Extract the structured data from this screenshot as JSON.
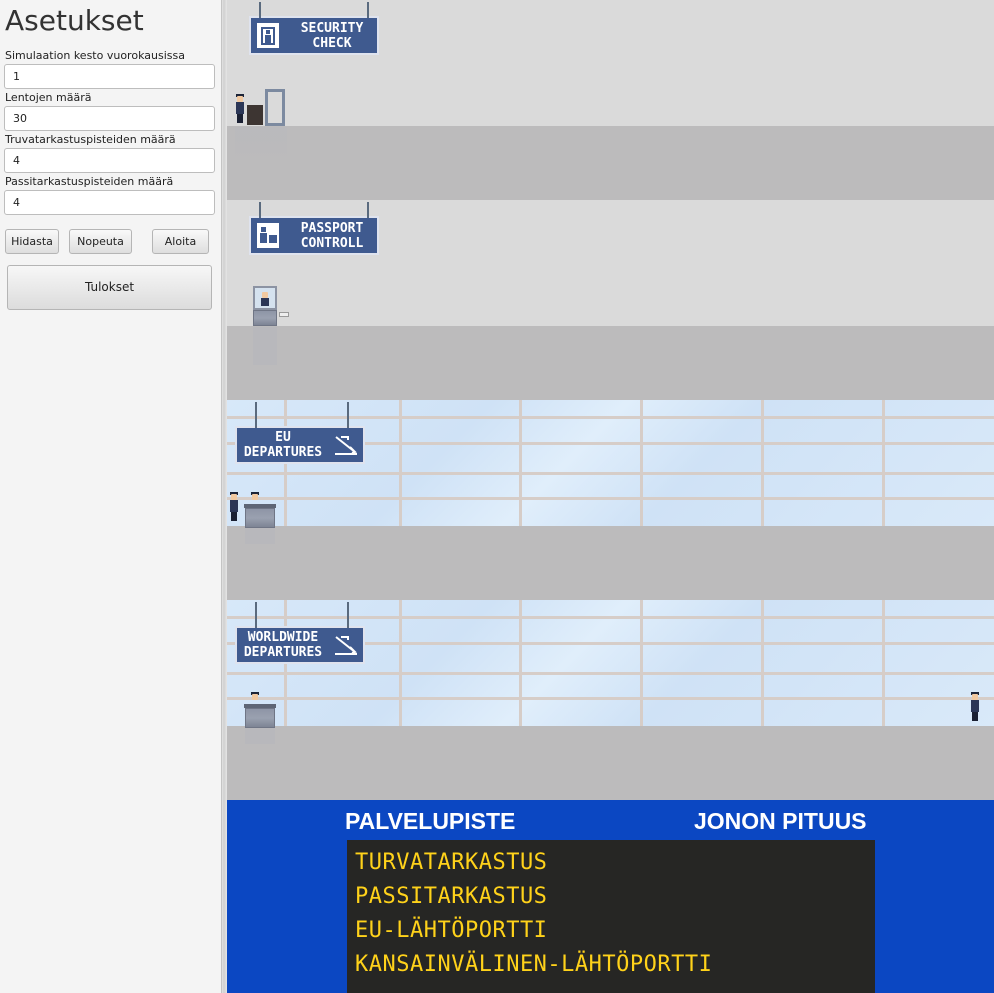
{
  "settings": {
    "title": "Asetukset",
    "fields": [
      {
        "label": "Simulaation kesto vuorokausissa",
        "value": "1"
      },
      {
        "label": "Lentojen määrä",
        "value": "30"
      },
      {
        "label": "Truvatarkastuspisteiden määrä",
        "value": "4"
      },
      {
        "label": "Passitarkastuspisteiden määrä",
        "value": "4"
      }
    ],
    "buttons": {
      "slow": "Hidasta",
      "fast": "Nopeuta",
      "start": "Aloita",
      "results": "Tulokset"
    }
  },
  "zones": {
    "security": {
      "sign_line1": "SECURITY",
      "sign_line2": "CHECK",
      "icon": "security-check-icon"
    },
    "passport": {
      "sign_line1": "PASSPORT",
      "sign_line2": "CONTROLL",
      "icon": "passport-control-icon"
    },
    "eu": {
      "sign_line1": "EU",
      "sign_line2": "DEPARTURES",
      "icon": "departures-plane-icon"
    },
    "worldwide": {
      "sign_line1": "WORLDWIDE",
      "sign_line2": "DEPARTURES",
      "icon": "departures-plane-icon"
    }
  },
  "board": {
    "header_service": "PALVELUPISTE",
    "header_queue": "JONON PITUUS",
    "rows": [
      "TURVATARKASTUS",
      "PASSITARKASTUS",
      "EU-LÄHTÖPORTTI",
      "KANSAINVÄLINEN-LÄHTÖPORTTI"
    ]
  },
  "colors": {
    "board_bg": "#0b47c2",
    "board_text": "#ffd21a",
    "sign_bg": "#3f5a8f",
    "floor": "#bcbbbc",
    "wall": "#dadada"
  }
}
